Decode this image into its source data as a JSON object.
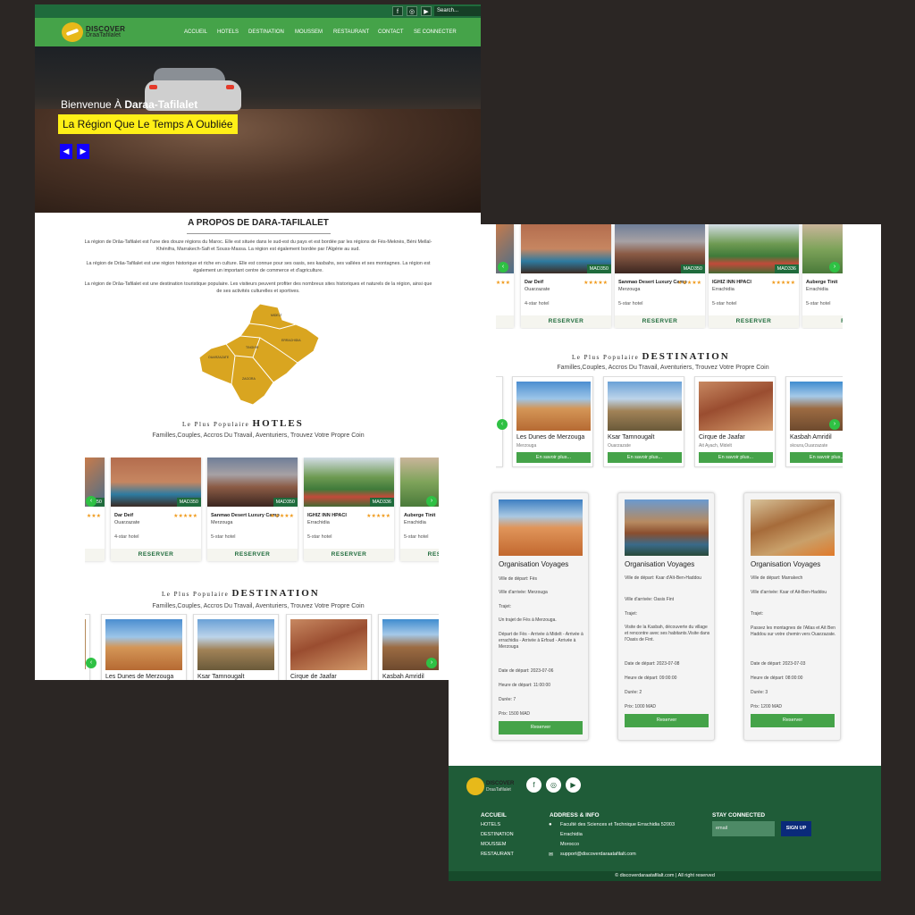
{
  "topbar": {
    "icons": [
      "facebook-icon",
      "instagram-icon",
      "youtube-icon"
    ],
    "search_placeholder": "Search..."
  },
  "logo": {
    "line1": "DISCOVER",
    "line2": "DraaTafilalet"
  },
  "nav": [
    "ACCUEIL",
    "HOTELS",
    "DESTINATION",
    "MOUSSEM",
    "RESTAURANT",
    "CONTACT",
    "SE CONNECTER"
  ],
  "hero": {
    "welcome": "Bienvenue À ",
    "welcome_bold": "Daraa-Tafilalet",
    "tagline": "La Région Que Le Temps A Oubliée",
    "prev": "◀",
    "next": "▶"
  },
  "about": {
    "title": "A PROPOS DE DARA-TAFILALET",
    "p1": "La région de Drâa-Tafilalet est l'une des douze régions du Maroc. Elle est située dans le sud-est du pays et est bordée par les régions de Fès-Meknès, Béni Mellal-Khénifra, Marrakech-Safi et Souss-Massa. La région est également bordée par l'Algérie au sud.",
    "p2": "La région de Drâa-Tafilalet est une région historique et riche en culture. Elle est connue pour ses oasis, ses kasbahs, ses vallées et ses montagnes. La région est également un important centre de commerce et d'agriculture.",
    "p3": "La région de Drâa-Tafilalet est une destination touristique populaire. Les visiteurs peuvent profiter des nombreux sites historiques et naturels de la région, ainsi que de ses activités culturelles et sportives.",
    "map_labels": [
      "MIDELT",
      "ERRACHIDIA",
      "TINGHIR",
      "OUARZAZATE",
      "ZAGORA"
    ]
  },
  "hotels": {
    "prefix": "Le Plus Populaire",
    "title": "HOTLES",
    "desc": "Familles,Couples, Accros Du Travail, Aventuriers, Trouvez Votre Propre Coin",
    "items": [
      {
        "name": "Dar Deif",
        "location": "Ouarzazate",
        "price": "MAD350",
        "class": "4-star hotel",
        "stars": "★★★★★"
      },
      {
        "name": "Sanmao Desert Luxury Camp",
        "location": "Merzouga",
        "price": "MAD350",
        "class": "5-star hotel",
        "stars": "★★★★★"
      },
      {
        "name": "IGHIZ INN HPACI",
        "location": "Errachidia",
        "price": "MAD336",
        "class": "5-star hotel",
        "stars": "★★★★★"
      },
      {
        "name": "Auberge Tinit",
        "location": "Errachidia",
        "price": "",
        "class": "5-star hotel",
        "stars": ""
      }
    ],
    "partial_stars": "★★★",
    "partial_price": "350",
    "reserve": "RESERVER",
    "reserve_cut": "RES"
  },
  "destinations": {
    "prefix": "Le Plus Populaire",
    "title": "DESTINATION",
    "desc": "Familles,Couples, Accros Du Travail, Aventuriers, Trouvez Votre Propre Coin",
    "items": [
      {
        "name": "Les Dunes de Merzouga",
        "location": "Merzouga"
      },
      {
        "name": "Ksar Tamnougalt",
        "location": "Ouarzazate"
      },
      {
        "name": "Cirque de Jaafar",
        "location": "Ait Ayach, Midelt"
      },
      {
        "name": "Kasbah Amridil",
        "location": "skoura,Ouarzazate"
      }
    ],
    "more": "En savoir plus..."
  },
  "trips": {
    "title": "Organisation Voyages",
    "reserve": "Reserver",
    "items": [
      {
        "depart": "Ville de départ: Fès",
        "arrivee": "Ville d'arrivée: Merzouga",
        "trajet": "Trajet:",
        "desc": "Un trajet de Fès à Merzouga.",
        "detail": "Départ de Fès - Arrivée à Midelt - Arrivée à errachidia - Arrivée à Erfoud - Arrivée à Merzouga",
        "date": "Date de départ: 2023-07-06",
        "heure": "Heure de départ: 11:00:00",
        "duree": "Durée: 7",
        "prix": "Prix: 1500 MAD"
      },
      {
        "depart": "Ville de départ: Ksar d'Aït-Ben-Haddou",
        "arrivee": "Ville d'arrivée: Oasis Fint",
        "trajet": "Trajet:",
        "desc": "Visite de la Kasbah, découverte du village et rencontre avec ses habitants.Visite dans l'Oasis de Fint.",
        "detail": "",
        "date": "Date de départ: 2023-07-08",
        "heure": "Heure de départ: 09:00:00",
        "duree": "Durée: 2",
        "prix": "Prix: 1000 MAD"
      },
      {
        "depart": "Ville de départ: Marrakech",
        "arrivee": "Ville d'arrivée: Ksar of Ait-Ben-Haddou",
        "trajet": "Trajet:",
        "desc": "Passez les montagnes de l'Atlas et Aït Ben Haddou sur votre chemin vers Ouarzazate.",
        "detail": "",
        "date": "Date de départ: 2023-07-03",
        "heure": "Heure de départ: 08:00:00",
        "duree": "Durée: 3",
        "prix": "Prix: 1200 MAD"
      }
    ]
  },
  "footer": {
    "logo1": "DISCOVER",
    "logo2": "DraaTafilalet",
    "col1_title": "ACCUEIL",
    "col1": [
      "HOTELS",
      "DESTINATION",
      "MOUSSEM",
      "RESTAURANT"
    ],
    "col2_title": "ADDRESS & INFO",
    "address": [
      "Faculté des Sciences et Technique Errachidia 52003",
      "Errachidia",
      "Morocco"
    ],
    "email": "support@discoverdaraatafilalt.com",
    "col3_title": "STAY CONNECTED",
    "email_placeholder": "email",
    "signup": "SIGN UP",
    "copyright": "© discoverdaraatafilalt.com | All right reserved"
  },
  "colors": {
    "green": "#45a349",
    "dark_green": "#1f5c38",
    "yellow": "#ffef17",
    "blue": "#1200ff"
  }
}
